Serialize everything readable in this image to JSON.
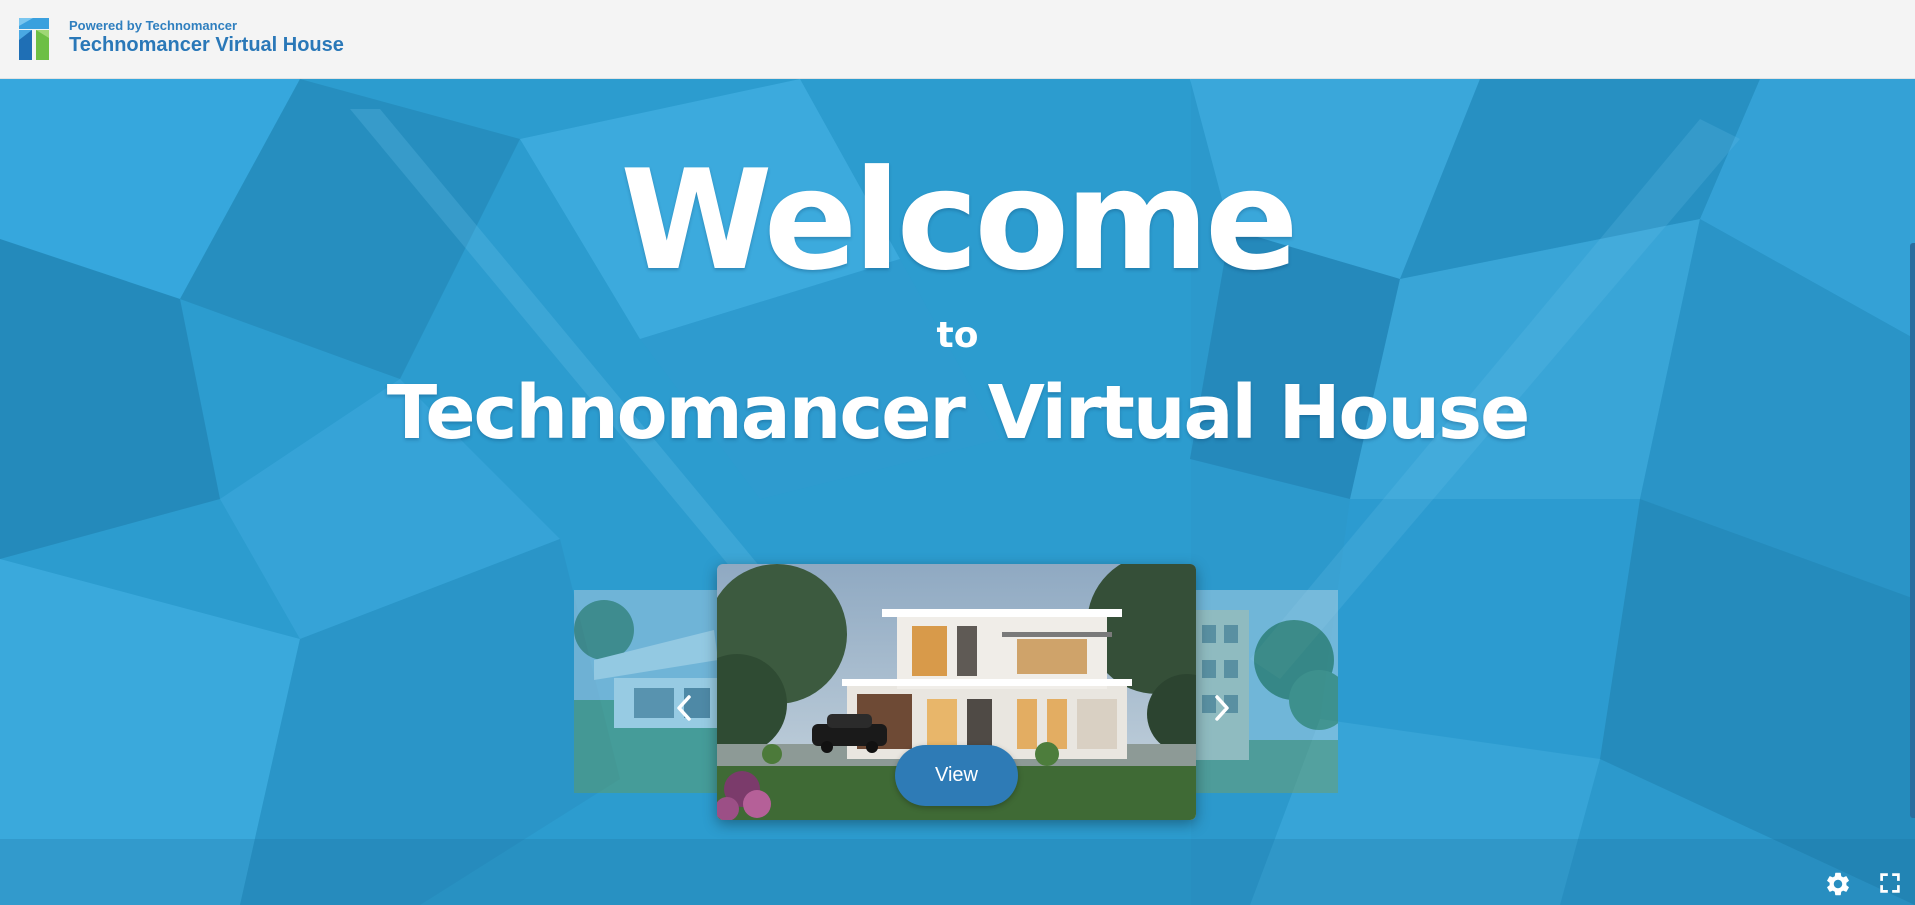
{
  "header": {
    "powered_by": "Powered by Technomancer",
    "app_title": "Technomancer Virtual House"
  },
  "hero": {
    "welcome": "Welcome",
    "to": "to",
    "subtitle": "Technomancer Virtual House"
  },
  "carousel": {
    "prev_icon": "chevron-left-icon",
    "next_icon": "chevron-right-icon",
    "view_label": "View"
  },
  "controls": {
    "settings_icon": "gear-icon",
    "fullscreen_icon": "fullscreen-icon"
  },
  "colors": {
    "header_bg": "#f4f4f4",
    "brand_blue": "#2e7bb6",
    "background_blue": "#2c9ccf"
  }
}
